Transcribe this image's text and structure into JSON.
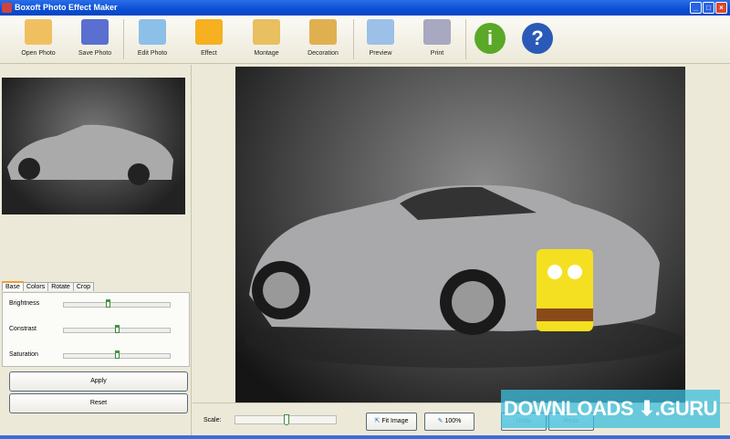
{
  "window": {
    "title": "Boxoft Photo Effect Maker",
    "min": "_",
    "max": "□",
    "close": "×"
  },
  "toolbar": [
    {
      "label": "Open Photo",
      "icon": "folder-icon",
      "color": "#f0c060"
    },
    {
      "label": "Save Photo",
      "icon": "floppy-disk-icon",
      "color": "#5a6fd0"
    },
    {
      "label": "Edit Photo",
      "icon": "edit-grid-pencil-icon",
      "color": "#8cc0e8"
    },
    {
      "label": "Effect",
      "icon": "sun-icon",
      "color": "#f6b020"
    },
    {
      "label": "Montage",
      "icon": "layers-download-icon",
      "color": "#e8c060"
    },
    {
      "label": "Decoration",
      "icon": "picture-frame-icon",
      "color": "#e0b050"
    },
    {
      "label": "Preview",
      "icon": "preview-magnifier-icon",
      "color": "#9cc0e8"
    },
    {
      "label": "Print",
      "icon": "printer-icon",
      "color": "#a8a8c0"
    }
  ],
  "info": {
    "glyph": "i",
    "color": "#5aa828"
  },
  "help": {
    "glyph": "?",
    "color": "#2a5ab8"
  },
  "tabs": [
    "Base",
    "Colors",
    "Rotate",
    "Crop"
  ],
  "adjustments": [
    {
      "label": "Brightness",
      "value": 0.41
    },
    {
      "label": "Constrast",
      "value": 0.5
    },
    {
      "label": "Saturation",
      "value": 0.5
    }
  ],
  "buttons": {
    "apply": "Apply",
    "reset": "Reset"
  },
  "bottom": {
    "scale_label": "Scale:",
    "scale_value": 0.5,
    "fit": "Fit Image",
    "actual": "100%",
    "undo": "Undo",
    "redo": "Redo"
  },
  "watermark": "DOWNLOADS ⬇.GURU"
}
